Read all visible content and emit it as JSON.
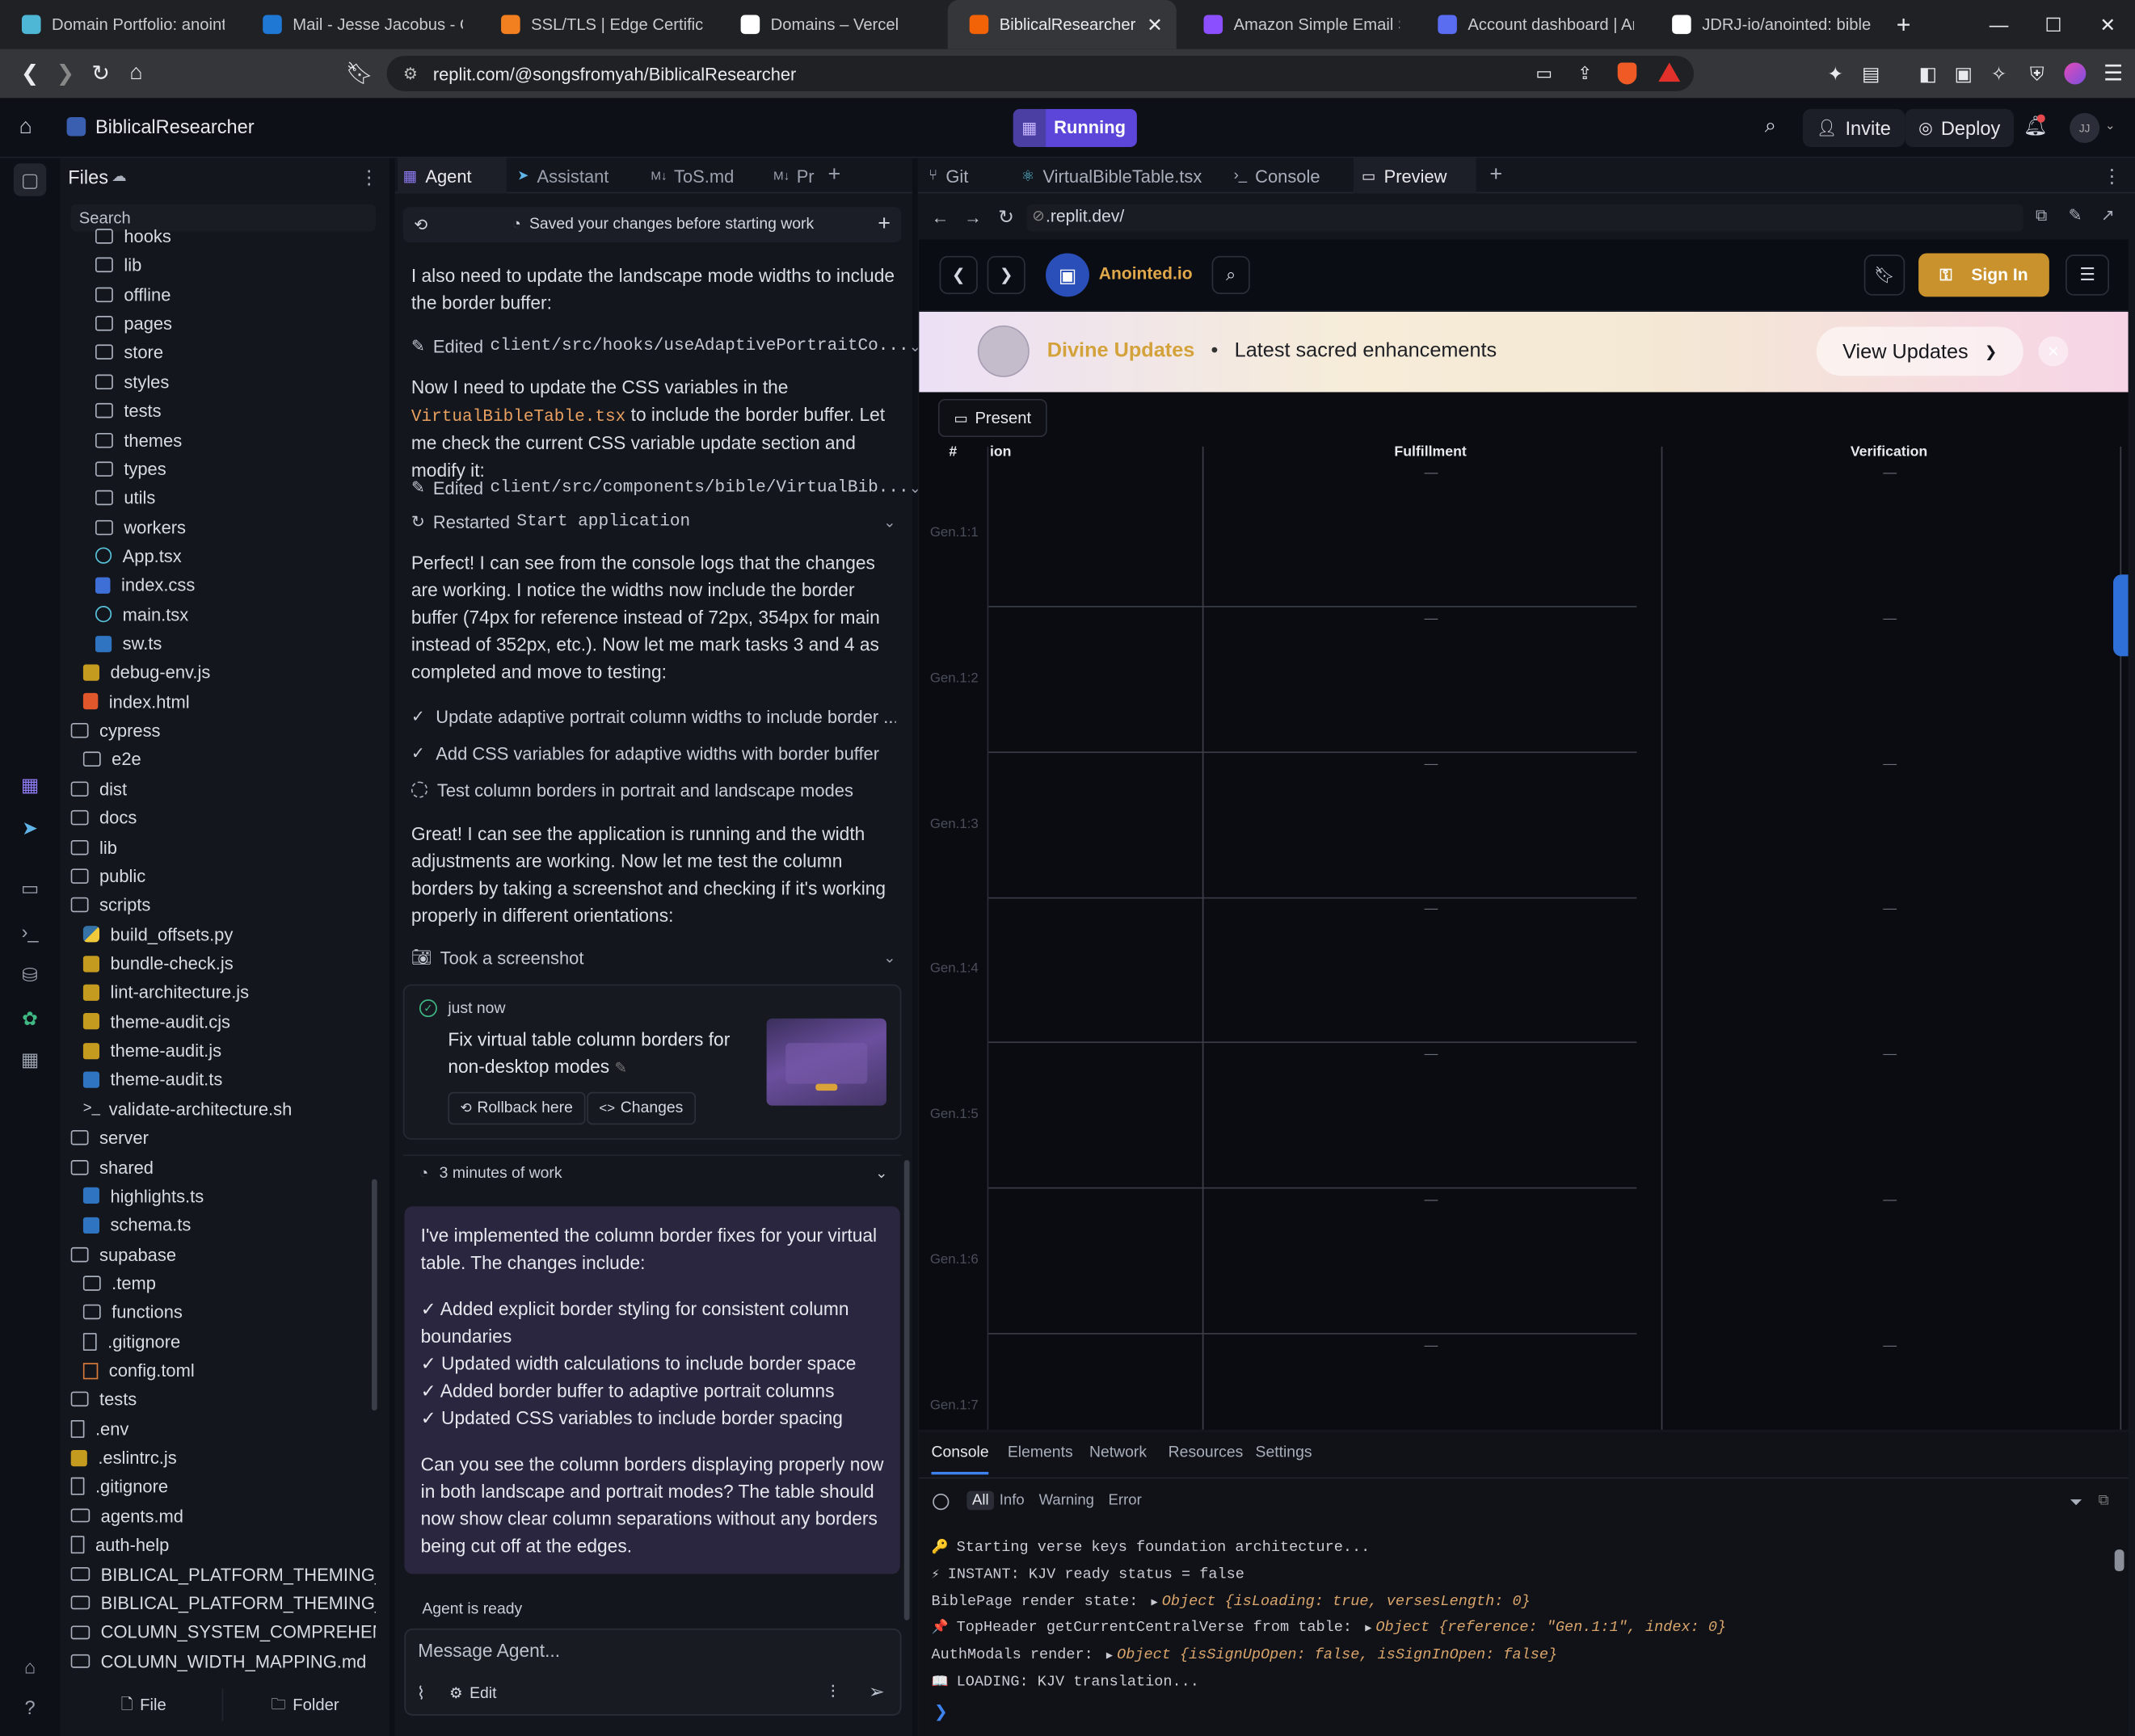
{
  "browser": {
    "tabs": [
      {
        "label": "Domain Portfolio: anointed",
        "color": "#4fb7d6"
      },
      {
        "label": "Mail - Jesse Jacobus - Outlc",
        "color": "#1e78d4"
      },
      {
        "label": "SSL/TLS | Edge Certificates",
        "color": "#f38020"
      },
      {
        "label": "Domains – Vercel",
        "color": "#ffffff"
      },
      {
        "label": "BiblicalResearcher - Re",
        "color": "#f26207"
      },
      {
        "label": "Amazon Simple Email Servi",
        "color": "#8c4fff"
      },
      {
        "label": "Account dashboard | Amaz",
        "color": "#5a6cf0"
      },
      {
        "label": "JDRJ-io/anointed: biblewel",
        "color": "#ffffff"
      }
    ],
    "url": "replit.com/@songsfromyah/BiblicalResearcher"
  },
  "replit": {
    "project_name": "BiblicalResearcher",
    "run_status": "Running",
    "invite_label": "Invite",
    "deploy_label": "Deploy",
    "avatar_initials": "JJ"
  },
  "files": {
    "title": "Files",
    "search_placeholder": "Search",
    "items": [
      {
        "label": "hooks",
        "type": "folder",
        "indent": 2
      },
      {
        "label": "lib",
        "type": "folder",
        "indent": 2
      },
      {
        "label": "offline",
        "type": "folder",
        "indent": 2
      },
      {
        "label": "pages",
        "type": "folder",
        "indent": 2
      },
      {
        "label": "store",
        "type": "folder",
        "indent": 2
      },
      {
        "label": "styles",
        "type": "folder",
        "indent": 2
      },
      {
        "label": "tests",
        "type": "folder",
        "indent": 2
      },
      {
        "label": "themes",
        "type": "folder",
        "indent": 2
      },
      {
        "label": "types",
        "type": "folder",
        "indent": 2
      },
      {
        "label": "utils",
        "type": "folder",
        "indent": 2
      },
      {
        "label": "workers",
        "type": "folder",
        "indent": 2
      },
      {
        "label": "App.tsx",
        "type": "react",
        "indent": 2
      },
      {
        "label": "index.css",
        "type": "css",
        "indent": 2
      },
      {
        "label": "main.tsx",
        "type": "react",
        "indent": 2
      },
      {
        "label": "sw.ts",
        "type": "ts",
        "indent": 2
      },
      {
        "label": "debug-env.js",
        "type": "js",
        "indent": 1
      },
      {
        "label": "index.html",
        "type": "html",
        "indent": 1
      },
      {
        "label": "cypress",
        "type": "folder",
        "indent": 0
      },
      {
        "label": "e2e",
        "type": "folder",
        "indent": 1
      },
      {
        "label": "dist",
        "type": "folder",
        "indent": 0
      },
      {
        "label": "docs",
        "type": "folder",
        "indent": 0
      },
      {
        "label": "lib",
        "type": "folder",
        "indent": 0
      },
      {
        "label": "public",
        "type": "folder",
        "indent": 0
      },
      {
        "label": "scripts",
        "type": "folder",
        "indent": 0
      },
      {
        "label": "build_offsets.py",
        "type": "py",
        "indent": 1
      },
      {
        "label": "bundle-check.js",
        "type": "js",
        "indent": 1
      },
      {
        "label": "lint-architecture.js",
        "type": "js",
        "indent": 1
      },
      {
        "label": "theme-audit.cjs",
        "type": "js",
        "indent": 1
      },
      {
        "label": "theme-audit.js",
        "type": "js",
        "indent": 1
      },
      {
        "label": "theme-audit.ts",
        "type": "ts",
        "indent": 1
      },
      {
        "label": "validate-architecture.sh",
        "type": "sh",
        "indent": 1
      },
      {
        "label": "server",
        "type": "folder",
        "indent": 0
      },
      {
        "label": "shared",
        "type": "folder",
        "indent": 0
      },
      {
        "label": "highlights.ts",
        "type": "ts",
        "indent": 1
      },
      {
        "label": "schema.ts",
        "type": "ts",
        "indent": 1
      },
      {
        "label": "supabase",
        "type": "folder",
        "indent": 0
      },
      {
        "label": ".temp",
        "type": "folder",
        "indent": 1
      },
      {
        "label": "functions",
        "type": "folder",
        "indent": 1
      },
      {
        "label": ".gitignore",
        "type": "file",
        "indent": 1
      },
      {
        "label": "config.toml",
        "type": "toml",
        "indent": 1
      },
      {
        "label": "tests",
        "type": "folder",
        "indent": 0
      },
      {
        "label": ".env",
        "type": "file",
        "indent": 0
      },
      {
        "label": ".eslintrc.js",
        "type": "js",
        "indent": 0
      },
      {
        "label": ".gitignore",
        "type": "file",
        "indent": 0
      },
      {
        "label": "agents.md",
        "type": "md",
        "indent": 0
      },
      {
        "label": "auth-help",
        "type": "file",
        "indent": 0
      },
      {
        "label": "BIBLICAL_PLATFORM_THEMING_...",
        "type": "md",
        "indent": 0
      },
      {
        "label": "BIBLICAL_PLATFORM_THEMING_...",
        "type": "md",
        "indent": 0
      },
      {
        "label": "COLUMN_SYSTEM_COMPREHENSI...",
        "type": "md",
        "indent": 0
      },
      {
        "label": "COLUMN_WIDTH_MAPPING.md",
        "type": "md",
        "indent": 0
      }
    ],
    "new_file_label": "File",
    "new_folder_label": "Folder"
  },
  "agent_panel": {
    "tabs": [
      "Agent",
      "Assistant",
      "ToS.md",
      "Pr"
    ],
    "checkpoint_text": "Saved your changes before starting work",
    "msg1": "I also need to update the landscape mode widths to include the border buffer:",
    "edit1_prefix": "Edited",
    "edit1_path": "client/src/hooks/useAdaptivePortraitCo...",
    "msg2_a": "Now I need to update the CSS variables in the",
    "msg2_code": "VirtualBibleTable.tsx",
    "msg2_b": "to include the border buffer. Let me check the current CSS variable update section and modify it:",
    "edit2_prefix": "Edited",
    "edit2_path": "client/src/components/bible/VirtualBib...",
    "restart_prefix": "Restarted",
    "restart_name": "Start application",
    "msg3": "Perfect! I can see from the console logs that the changes are working. I notice the widths now include the border buffer (74px for reference instead of 72px, 354px for main instead of 352px, etc.). Now let me mark tasks 3 and 4 as completed and move to testing:",
    "tasks": [
      {
        "label": "Update adaptive portrait column widths to include border ...",
        "done": true
      },
      {
        "label": "Add CSS variables for adaptive widths with border buffer",
        "done": true
      },
      {
        "label": "Test column borders in portrait and landscape modes",
        "done": false
      }
    ],
    "msg4": "Great! I can see the application is running and the width adjustments are working. Now let me test the column borders by taking a screenshot and checking if it's working properly in different orientations:",
    "screenshot_action": "Took a screenshot",
    "checkpoint_card": {
      "time": "just now",
      "title": "Fix virtual table column borders for non-desktop modes",
      "rollback_label": "Rollback here",
      "changes_label": "Changes"
    },
    "work_summary": "3 minutes of work",
    "final_intro": "I've implemented the column border fixes for your virtual table. The changes include:",
    "final_points": [
      "✓ Added explicit border styling for consistent column boundaries",
      "✓ Updated width calculations to include border space",
      "✓ Added border buffer to adaptive portrait columns",
      "✓ Updated CSS variables to include border spacing"
    ],
    "final_question": "Can you see the column borders displaying properly now in both landscape and portrait modes? The table should now show clear column separations without any borders being cut off at the edges.",
    "status": "Agent is ready",
    "input_placeholder": "Message Agent...",
    "edit_label": "Edit"
  },
  "right_panel": {
    "tabs": [
      "Git",
      "VirtualBibleTable.tsx",
      "Console",
      "Preview"
    ],
    "preview_url": ".replit.dev/",
    "site": {
      "brand": "Anointed.io",
      "signin_label": "Sign In",
      "banner_title": "Divine Updates",
      "banner_sep": "•",
      "banner_text": "Latest sacred enhancements",
      "banner_button": "View Updates",
      "present_label": "Present",
      "col_headers": [
        "#",
        "ion",
        "Fulfillment",
        "Verification"
      ],
      "rows": [
        "Gen.1:1",
        "Gen.1:2",
        "Gen.1:3",
        "Gen.1:4",
        "Gen.1:5",
        "Gen.1:6",
        "Gen.1:7"
      ],
      "empty_cell": "—"
    }
  },
  "devtools": {
    "tabs": [
      "Console",
      "Elements",
      "Network",
      "Resources",
      "Settings"
    ],
    "filters": [
      "All",
      "Info",
      "Warning",
      "Error"
    ],
    "logs": [
      {
        "icon": "🔑",
        "text": "Starting verse keys foundation architecture..."
      },
      {
        "icon": "⚡",
        "text": "INSTANT: KJV ready status = false"
      },
      {
        "icon": "",
        "text": "BiblePage render state: ",
        "obj": "Object {isLoading: true, versesLength: 0}"
      },
      {
        "icon": "📌",
        "text": "TopHeader getCurrentCentralVerse from table: ",
        "obj": "Object {reference: \"Gen.1:1\", index: 0}"
      },
      {
        "icon": "",
        "text": "AuthModals render: ",
        "obj": "Object {isSignUpOpen: false, isSignInOpen: false}"
      },
      {
        "icon": "📖",
        "text": "LOADING: KJV translation..."
      }
    ]
  },
  "colors": {
    "accent": "#7c5cf0",
    "gold": "#c9922c",
    "brand_blue": "#2a4fb8"
  }
}
